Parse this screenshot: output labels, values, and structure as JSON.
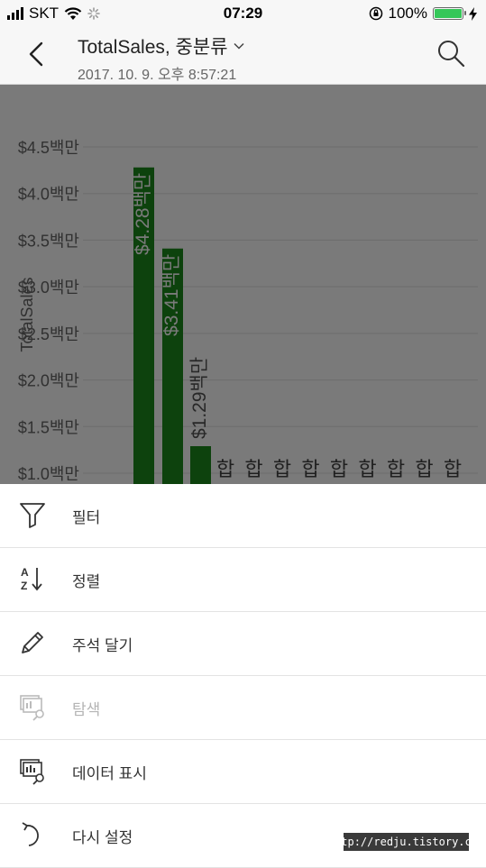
{
  "status_bar": {
    "carrier": "SKT",
    "time": "07:29",
    "battery_percent": "100%",
    "battery_level": 1.0
  },
  "header": {
    "title": "TotalSales, 중분류",
    "timestamp": "2017. 10. 9. 오후 8:57:21"
  },
  "chart_data": {
    "type": "bar",
    "ylabel": "TotalSales",
    "y_ticks": [
      "$1.0백만",
      "$1.5백만",
      "$2.0백만",
      "$2.5백만",
      "$3.0백만",
      "$3.5백만",
      "$4.0백만",
      "$4.5백만"
    ],
    "values": [
      4.28,
      3.41,
      1.29
    ],
    "data_labels": [
      "$4.28백만",
      "$3.41백만",
      "$1.29백만"
    ],
    "truncated_labels": [
      "합",
      "합",
      "합",
      "합",
      "합",
      "합",
      "합",
      "합",
      "합"
    ],
    "bar_color": "#1c8a1c",
    "ylim_visible": [
      0.9,
      4.6
    ]
  },
  "menu": {
    "items": [
      {
        "label": "필터",
        "icon": "filter-icon",
        "enabled": true
      },
      {
        "label": "정렬",
        "icon": "sort-az-icon",
        "enabled": true
      },
      {
        "label": "주석 달기",
        "icon": "pencil-icon",
        "enabled": true
      },
      {
        "label": "탐색",
        "icon": "explore-icon",
        "enabled": false
      },
      {
        "label": "데이터 표시",
        "icon": "show-data-icon",
        "enabled": true
      },
      {
        "label": "다시 설정",
        "icon": "reset-icon",
        "enabled": true
      }
    ]
  },
  "watermark": "http://redju.tistory.com"
}
